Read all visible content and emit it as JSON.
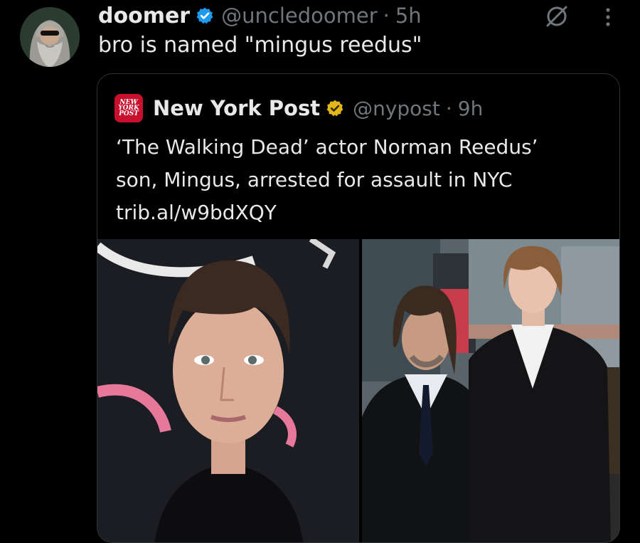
{
  "tweet": {
    "display_name": "doomer",
    "handle": "@uncledoomer",
    "separator": "·",
    "time": "5h",
    "text": "bro is named \"mingus reedus\"",
    "avatar_icon": "bearded-man-avatar",
    "actions": {
      "grok_icon": "grok-icon",
      "more_icon": "more-vertical-icon"
    }
  },
  "quote": {
    "logo_lines": [
      "NEW",
      "YORK",
      "POST"
    ],
    "display_name": "New York Post",
    "handle": "@nypost",
    "separator": "·",
    "time": "9h",
    "text_lines": [
      "‘The Walking Dead’ actor Norman Reedus’",
      "son, Mingus, arrested for assault in NYC",
      "trib.al/w9bdXQY"
    ],
    "images": [
      {
        "description_icon": "portrait-photo"
      },
      {
        "description_icon": "two-men-photo"
      }
    ]
  },
  "colors": {
    "background": "#000000",
    "text_primary": "#e7e9ea",
    "text_secondary": "#71767b",
    "border": "#2f3336",
    "verified_blue": "#1d9bf0",
    "verified_gold": "#e2b719",
    "nypost_red": "#c8102e"
  }
}
